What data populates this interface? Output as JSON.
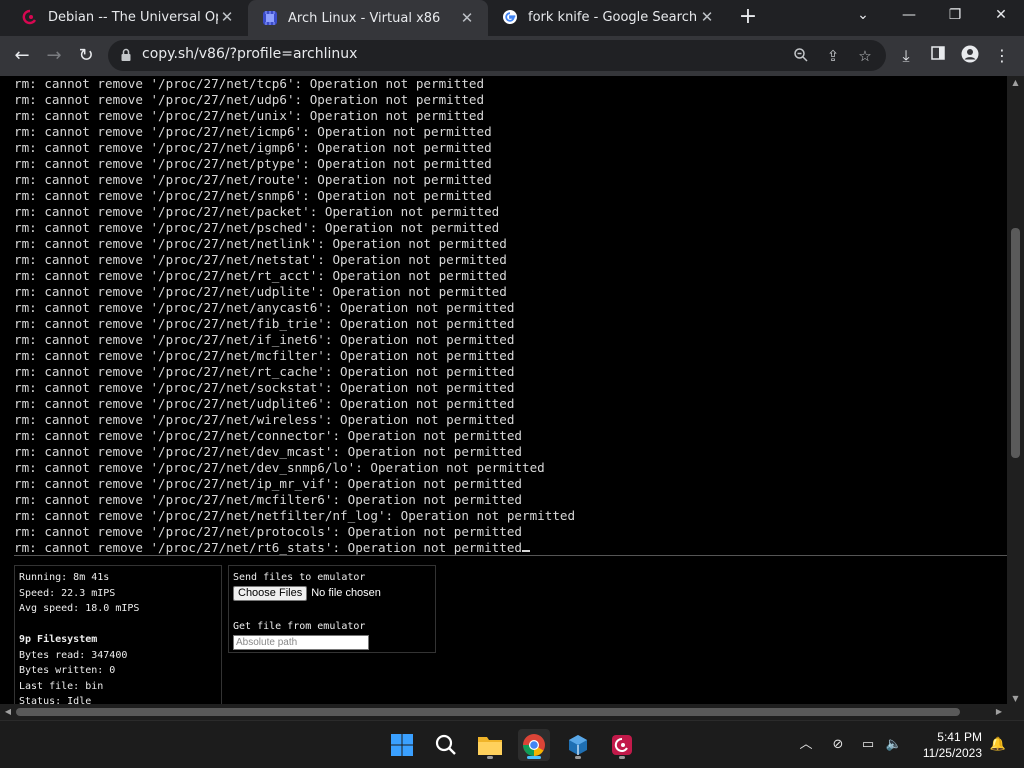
{
  "browser": {
    "tabs": [
      {
        "title": "Debian -- The Universal Operatin",
        "active": false
      },
      {
        "title": "Arch Linux - Virtual x86",
        "active": true
      },
      {
        "title": "fork knife - Google Search",
        "active": false
      }
    ],
    "new_tab": "+",
    "url": "copy.sh/v86/?profile=archlinux"
  },
  "terminal": {
    "lines": [
      "rm: cannot remove '/proc/27/net/tcp6': Operation not permitted",
      "rm: cannot remove '/proc/27/net/udp6': Operation not permitted",
      "rm: cannot remove '/proc/27/net/unix': Operation not permitted",
      "rm: cannot remove '/proc/27/net/icmp6': Operation not permitted",
      "rm: cannot remove '/proc/27/net/igmp6': Operation not permitted",
      "rm: cannot remove '/proc/27/net/ptype': Operation not permitted",
      "rm: cannot remove '/proc/27/net/route': Operation not permitted",
      "rm: cannot remove '/proc/27/net/snmp6': Operation not permitted",
      "rm: cannot remove '/proc/27/net/packet': Operation not permitted",
      "rm: cannot remove '/proc/27/net/psched': Operation not permitted",
      "rm: cannot remove '/proc/27/net/netlink': Operation not permitted",
      "rm: cannot remove '/proc/27/net/netstat': Operation not permitted",
      "rm: cannot remove '/proc/27/net/rt_acct': Operation not permitted",
      "rm: cannot remove '/proc/27/net/udplite': Operation not permitted",
      "rm: cannot remove '/proc/27/net/anycast6': Operation not permitted",
      "rm: cannot remove '/proc/27/net/fib_trie': Operation not permitted",
      "rm: cannot remove '/proc/27/net/if_inet6': Operation not permitted",
      "rm: cannot remove '/proc/27/net/mcfilter': Operation not permitted",
      "rm: cannot remove '/proc/27/net/rt_cache': Operation not permitted",
      "rm: cannot remove '/proc/27/net/sockstat': Operation not permitted",
      "rm: cannot remove '/proc/27/net/udplite6': Operation not permitted",
      "rm: cannot remove '/proc/27/net/wireless': Operation not permitted",
      "rm: cannot remove '/proc/27/net/connector': Operation not permitted",
      "rm: cannot remove '/proc/27/net/dev_mcast': Operation not permitted",
      "rm: cannot remove '/proc/27/net/dev_snmp6/lo': Operation not permitted",
      "rm: cannot remove '/proc/27/net/ip_mr_vif': Operation not permitted",
      "rm: cannot remove '/proc/27/net/mcfilter6': Operation not permitted",
      "rm: cannot remove '/proc/27/net/netfilter/nf_log': Operation not permitted",
      "rm: cannot remove '/proc/27/net/protocols': Operation not permitted",
      "rm: cannot remove '/proc/27/net/rt6_stats': Operation not permitted"
    ]
  },
  "stats": {
    "running": "Running: 8m 41s",
    "speed": "Speed: 22.3 mIPS",
    "avg_speed": "Avg speed: 18.0 mIPS",
    "fs_title": "9p Filesystem",
    "bytes_read": "Bytes read: 347400",
    "bytes_written": "Bytes written: 0",
    "last_file": "Last file: bin",
    "status": "Status: Idle"
  },
  "files": {
    "send_label": "Send files to emulator",
    "choose_button": "Choose Files",
    "no_file": "No file chosen",
    "get_label": "Get file from emulator",
    "path_placeholder": "Absolute path"
  },
  "taskbar": {
    "time": "5:41 PM",
    "date": "11/25/2023"
  },
  "colors": {
    "chrome_dark": "#202124",
    "chrome_toolbar": "#35363a",
    "terminal_bg": "#000000",
    "terminal_fg": "#d8d8d8",
    "taskbar": "#1c1c1c",
    "accent": "#4cc2ff"
  }
}
